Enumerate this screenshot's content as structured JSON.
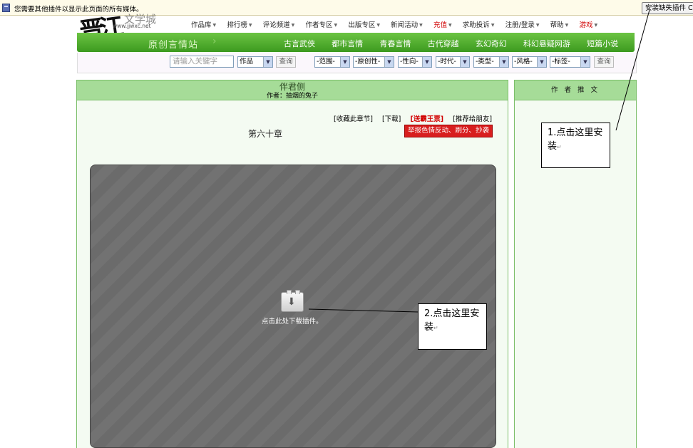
{
  "plugin_bar": {
    "message": "您需要其他插件以显示此页面的所有媒体。",
    "install_button": "安装缺失插件 C"
  },
  "header": {
    "logo_calligraphy": "晋江",
    "logo_title": "文学城",
    "logo_url": "www.jjwxc.net",
    "top_nav": [
      {
        "label": "作品库",
        "red": false
      },
      {
        "label": "排行榜",
        "red": false
      },
      {
        "label": "评论频道",
        "red": false
      },
      {
        "label": "作者专区",
        "red": false
      },
      {
        "label": "出版专区",
        "red": false
      },
      {
        "label": "新闻活动",
        "red": false
      },
      {
        "label": "充值",
        "red": true
      },
      {
        "label": "求助投诉",
        "red": false
      },
      {
        "label": "注册/登录",
        "red": false
      },
      {
        "label": "帮助",
        "red": false
      },
      {
        "label": "游戏",
        "red": true
      }
    ],
    "site_section": "原创言情站",
    "green_nav": [
      "古言武侠",
      "都市言情",
      "青春言情",
      "古代穿越",
      "玄幻奇幻",
      "科幻悬疑网游",
      "短篇小说"
    ]
  },
  "search": {
    "placeholder": "请输入关键字",
    "type_select": "作品",
    "query_label": "查询",
    "filters": [
      "-范围-",
      "-原创性-",
      "-性向-",
      "-时代-",
      "-类型-",
      "-风格-",
      "-标签-"
    ],
    "query_label_2": "查询"
  },
  "book": {
    "title": "伴君侧",
    "author": "作者：抽烟的兔子",
    "links": {
      "bookmark": "[收藏此章节]",
      "download": "[下载]",
      "gift": "[送霸王票]",
      "recommend": "[推荐给朋友]"
    },
    "chapter": "第六十章",
    "report_button": "举报色情反动、刷分、抄袭",
    "plugin_text": "点击此处下载插件。"
  },
  "side": {
    "heading": "作 者 推 文"
  },
  "callouts": {
    "first": "1.点击这里安装",
    "second": "2.点击这里安装",
    "return_mark": "↵"
  }
}
